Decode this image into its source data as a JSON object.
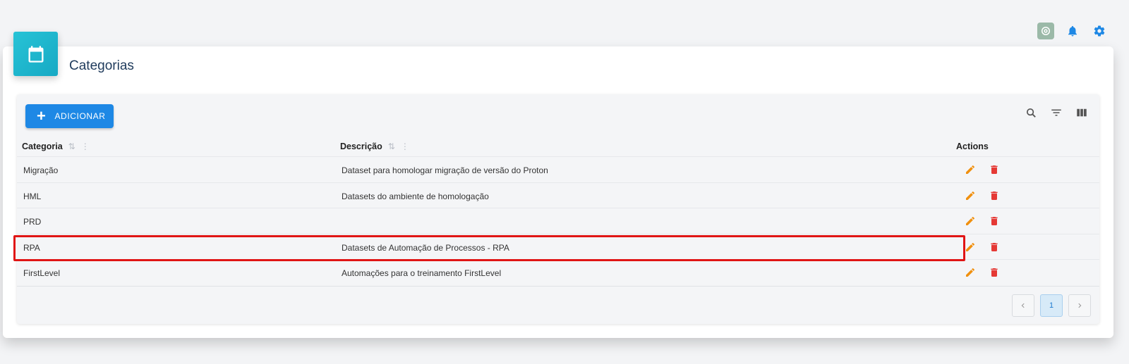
{
  "page": {
    "title": "Categorias"
  },
  "toolbar": {
    "add_label": "ADICIONAR"
  },
  "table": {
    "headers": {
      "categoria": "Categoria",
      "descricao": "Descrição",
      "actions": "Actions"
    },
    "rows": [
      {
        "categoria": "Migração",
        "descricao": "Dataset para homologar migração de versão do Proton"
      },
      {
        "categoria": "HML",
        "descricao": "Datasets do ambiente de homologação"
      },
      {
        "categoria": "PRD",
        "descricao": ""
      },
      {
        "categoria": "RPA",
        "descricao": "Datasets de Automação de Processos - RPA"
      },
      {
        "categoria": "FirstLevel",
        "descricao": "Automações para o treinamento FirstLevel"
      }
    ]
  },
  "pagination": {
    "current_page": "1",
    "prev_icon": "chevron-left-icon",
    "next_icon": "chevron-right-icon"
  },
  "colors": {
    "accent": "#1e88e5",
    "edit": "#f0900f",
    "delete": "#e53935",
    "highlight": "#e01515",
    "header_icon_bg": "#1fb6cf"
  },
  "icons": {
    "top": [
      "ai-assistant-icon",
      "bell-icon",
      "gear-icon"
    ],
    "card": "calendar-icon",
    "tools": [
      "search-icon",
      "filter-icon",
      "columns-icon"
    ]
  }
}
